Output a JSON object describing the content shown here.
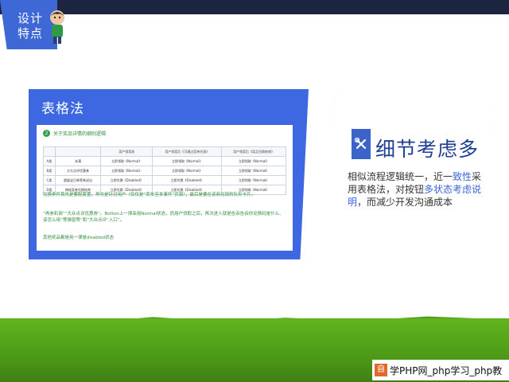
{
  "header": {
    "corner_line1": "设计",
    "corner_line2": "特点"
  },
  "left_card": {
    "title": "表格法",
    "section_number": "2",
    "section_title": "关于奖品详情的细则逻辑",
    "table": {
      "headers": [
        "",
        "",
        "用户领奖前",
        "用户领奖后《可通过奖券兑现》",
        "用户领奖后《奖品兑换结束》"
      ],
      "rows": [
        [
          "A类",
          "未满",
          "立即领取《Normal》",
          "立即领取《Normal》",
          "立即领取《Normal》"
        ],
        [
          "B类",
          "大众点评优惠券",
          "立即领取《Normal》",
          "立即领取《Normal》",
          "立即领取《Normal》"
        ],
        [
          "C类",
          "超级宝贝券等券送出",
          "立即兑换《Disabled》",
          "立即兑换《Disabled》",
          "立即领取《Normal》"
        ],
        [
          "D类",
          "神秘奖券兑换结束",
          "立即兑换《Disabled》",
          "立即兑换《Disabled》",
          "立即领取《Normal》"
        ]
      ]
    },
    "note1": "兑换条件首先是要配套置，再次是针对用户（仅仅是“而车至本事件”页面），最后是要在该商兑现的队形卡片。",
    "note2": "“再参彩商”“大众点评优惠券”。Botton上一律采用Normal状态，而用户领取之后，再次进入就是告诉告诉你兑换码是什么、该怎么用”等弹窗等“和”大众点评“入口”。",
    "note3": "其他奖品都是用一律是disabled状态"
  },
  "right_card": {
    "title": "细节考虑多",
    "icon_name": "tools-icon",
    "desc_part1": "相似流程逻辑统一，近一",
    "desc_highlight1": "致性",
    "desc_part2": "采用表格法，对按钮",
    "desc_highlight2": "多状态考虑说明",
    "desc_part3": "，而减少开发沟通成本"
  },
  "watermark": {
    "badge": "自",
    "text": "学PHP网_php学习_php教"
  },
  "colors": {
    "brand_blue": "#3d68e2",
    "dark_bar": "#1b2540",
    "grass_green": "#4c9a16",
    "note_green": "#2f8f3e"
  }
}
